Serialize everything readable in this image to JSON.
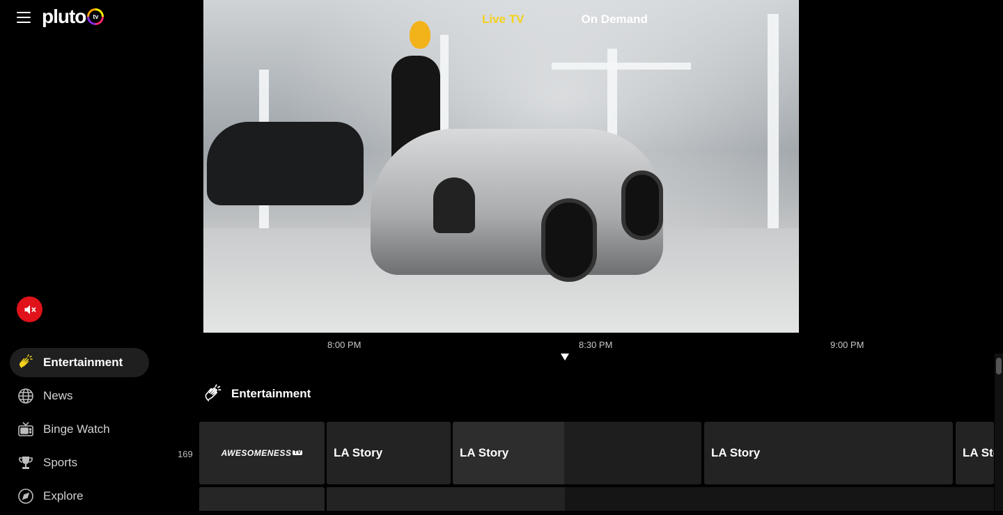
{
  "brand": {
    "logo_text": "pluto",
    "logo_badge": "tv"
  },
  "top_nav": {
    "tabs": [
      {
        "label": "Live TV",
        "active": true
      },
      {
        "label": "On Demand",
        "active": false
      }
    ]
  },
  "sidebar": {
    "categories": [
      {
        "label": "Entertainment",
        "icon": "clapping-hands-icon",
        "active": true
      },
      {
        "label": "News",
        "icon": "globe-icon",
        "active": false
      },
      {
        "label": "Binge Watch",
        "icon": "tv-icon",
        "active": false
      },
      {
        "label": "Sports",
        "icon": "trophy-icon",
        "active": false
      },
      {
        "label": "Explore",
        "icon": "compass-icon",
        "active": false
      }
    ]
  },
  "timeline": {
    "times": [
      "8:00 PM",
      "8:30 PM",
      "9:00 PM"
    ]
  },
  "guide": {
    "section_title": "Entertainment",
    "channels": [
      {
        "number": "169",
        "name": "AWESOMENESS",
        "badge": "TV",
        "programs": [
          "LA Story",
          "LA Story",
          "LA Story",
          "LA Story"
        ]
      }
    ]
  },
  "colors": {
    "accent": "#f5d21b",
    "mute": "#e0121a",
    "tile": "#232323",
    "active_pill": "#1f1f1f"
  }
}
